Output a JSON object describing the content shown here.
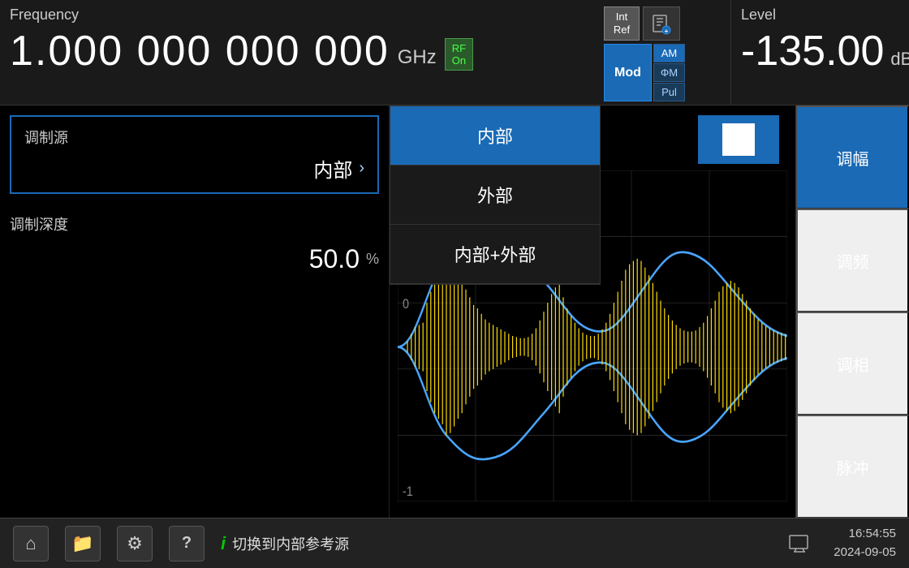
{
  "header": {
    "frequency_label": "Frequency",
    "frequency_value": "1.000 000 000 000",
    "frequency_unit": "GHz",
    "rf_on_label": "RF\nOn",
    "int_ref_line1": "Int",
    "int_ref_line2": "Ref",
    "mod_label": "Mod",
    "am_label": "AM",
    "fm_label": "ΦM",
    "pul_label": "Pul",
    "level_label": "Level",
    "level_value": "-135.00",
    "level_unit": "dBm"
  },
  "left_panel": {
    "source_label": "调制源",
    "source_value": "内部",
    "depth_label": "调制深度",
    "depth_value": "50.0",
    "depth_unit": "%"
  },
  "dropdown": {
    "items": [
      {
        "label": "内部",
        "selected": true
      },
      {
        "label": "外部",
        "selected": false
      },
      {
        "label": "内部+外部",
        "selected": false
      }
    ]
  },
  "right_sidebar": {
    "buttons": [
      {
        "label": "调幅",
        "active": true
      },
      {
        "label": "调频",
        "active": false
      },
      {
        "label": "调相",
        "active": false
      },
      {
        "label": "脉冲",
        "active": false
      }
    ]
  },
  "bottom_bar": {
    "home_icon": "⌂",
    "folder_icon": "📁",
    "settings_icon": "⚙",
    "help_icon": "?",
    "info_icon": "i",
    "status_text": "切换到内部参考源",
    "screen_icon": "🖥",
    "time": "16:54:55",
    "date": "2024-09-05"
  }
}
